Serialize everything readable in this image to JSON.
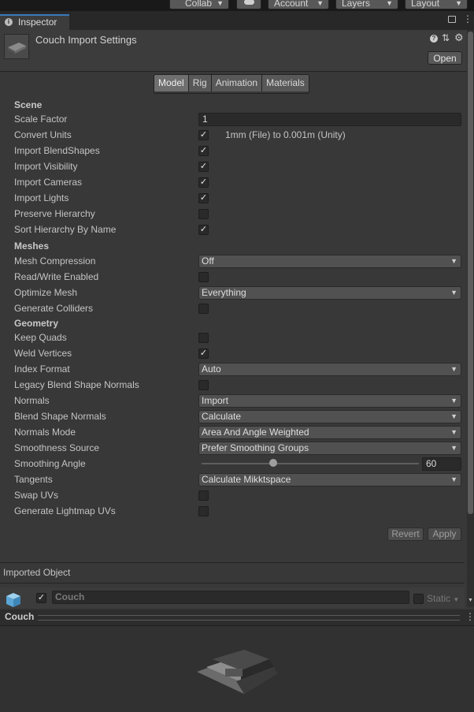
{
  "toolbar": {
    "collab": "Collab",
    "account": "Account",
    "layers": "Layers",
    "layout": "Layout"
  },
  "tab": {
    "label": "Inspector"
  },
  "header": {
    "title": "Couch Import Settings",
    "open_label": "Open"
  },
  "tabs": [
    {
      "label": "Model",
      "active": true
    },
    {
      "label": "Rig",
      "active": false
    },
    {
      "label": "Animation",
      "active": false
    },
    {
      "label": "Materials",
      "active": false
    }
  ],
  "sections": {
    "scene": "Scene",
    "meshes": "Meshes",
    "geometry": "Geometry"
  },
  "fields": {
    "scale_factor": {
      "label": "Scale Factor",
      "value": "1"
    },
    "convert_units": {
      "label": "Convert Units",
      "checked": true,
      "note": "1mm (File) to 0.001m (Unity)"
    },
    "import_blendshapes": {
      "label": "Import BlendShapes",
      "checked": true
    },
    "import_visibility": {
      "label": "Import Visibility",
      "checked": true
    },
    "import_cameras": {
      "label": "Import Cameras",
      "checked": true
    },
    "import_lights": {
      "label": "Import Lights",
      "checked": true
    },
    "preserve_hierarchy": {
      "label": "Preserve Hierarchy",
      "checked": false
    },
    "sort_hierarchy": {
      "label": "Sort Hierarchy By Name",
      "checked": true
    },
    "mesh_compression": {
      "label": "Mesh Compression",
      "value": "Off"
    },
    "read_write": {
      "label": "Read/Write Enabled",
      "checked": false
    },
    "optimize_mesh": {
      "label": "Optimize Mesh",
      "value": "Everything"
    },
    "generate_colliders": {
      "label": "Generate Colliders",
      "checked": false
    },
    "keep_quads": {
      "label": "Keep Quads",
      "checked": false
    },
    "weld_vertices": {
      "label": "Weld Vertices",
      "checked": true
    },
    "index_format": {
      "label": "Index Format",
      "value": "Auto"
    },
    "legacy_blend": {
      "label": "Legacy Blend Shape Normals",
      "checked": false
    },
    "normals": {
      "label": "Normals",
      "value": "Import"
    },
    "blend_shape_normals": {
      "label": "Blend Shape Normals",
      "value": "Calculate"
    },
    "normals_mode": {
      "label": "Normals Mode",
      "value": "Area And Angle Weighted"
    },
    "smoothness_source": {
      "label": "Smoothness Source",
      "value": "Prefer Smoothing Groups"
    },
    "smoothing_angle": {
      "label": "Smoothing Angle",
      "value": "60"
    },
    "tangents": {
      "label": "Tangents",
      "value": "Calculate Mikktspace"
    },
    "swap_uvs": {
      "label": "Swap UVs",
      "checked": false
    },
    "lightmap_uvs": {
      "label": "Generate Lightmap UVs",
      "checked": false
    }
  },
  "buttons": {
    "revert": "Revert",
    "apply": "Apply"
  },
  "imported": {
    "title": "Imported Object",
    "name": "Couch",
    "static_label": "Static"
  },
  "preview": {
    "title": "Couch"
  }
}
